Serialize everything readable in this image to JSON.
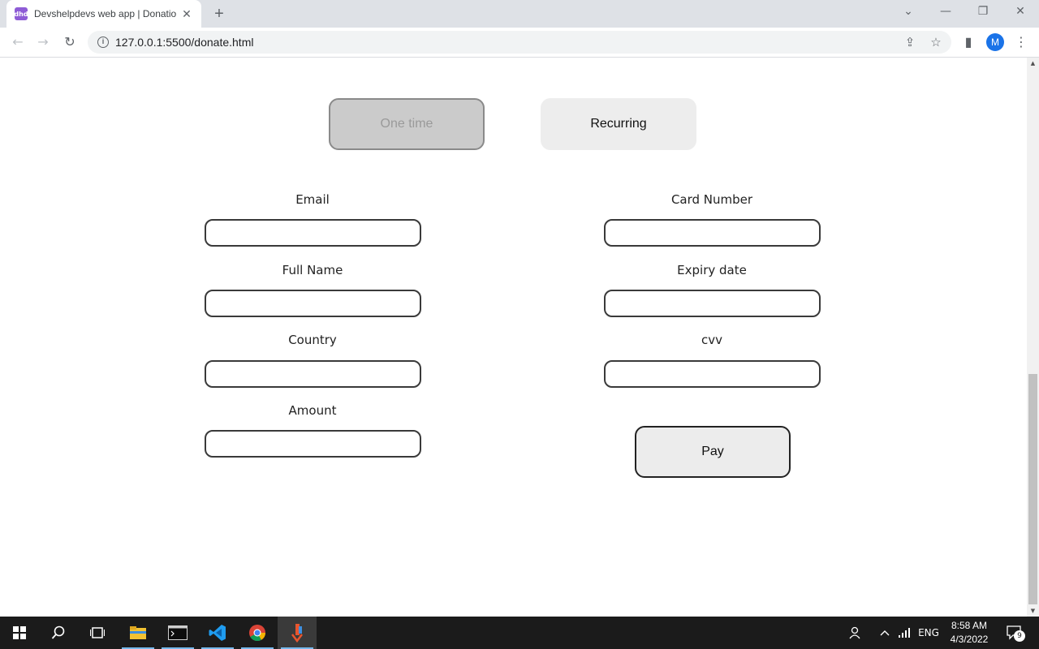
{
  "browser": {
    "tab_title": "Devshelpdevs web app | Donation",
    "favicon_text": "dhd",
    "new_tab_label": "+",
    "url": "127.0.0.1:5500/donate.html",
    "profile_initial": "M"
  },
  "donation": {
    "one_time_label": "One time",
    "recurring_label": "Recurring",
    "selected_frequency": "One time",
    "fields_left": [
      {
        "label": "Email",
        "value": ""
      },
      {
        "label": "Full Name",
        "value": ""
      },
      {
        "label": "Country",
        "value": ""
      },
      {
        "label": "Amount",
        "value": ""
      }
    ],
    "fields_right": [
      {
        "label": "Card Number",
        "value": ""
      },
      {
        "label": "Expiry date",
        "value": ""
      },
      {
        "label": "cvv",
        "value": ""
      }
    ],
    "pay_label": "Pay"
  },
  "taskbar": {
    "language": "ENG",
    "time": "8:58 AM",
    "date": "4/3/2022",
    "notification_count": "9"
  },
  "colors": {
    "accent": "#1a73e8",
    "favicon": "#8e5cd6",
    "taskbar": "#1b1b1b",
    "active_toggle": "#cbcbcb"
  }
}
